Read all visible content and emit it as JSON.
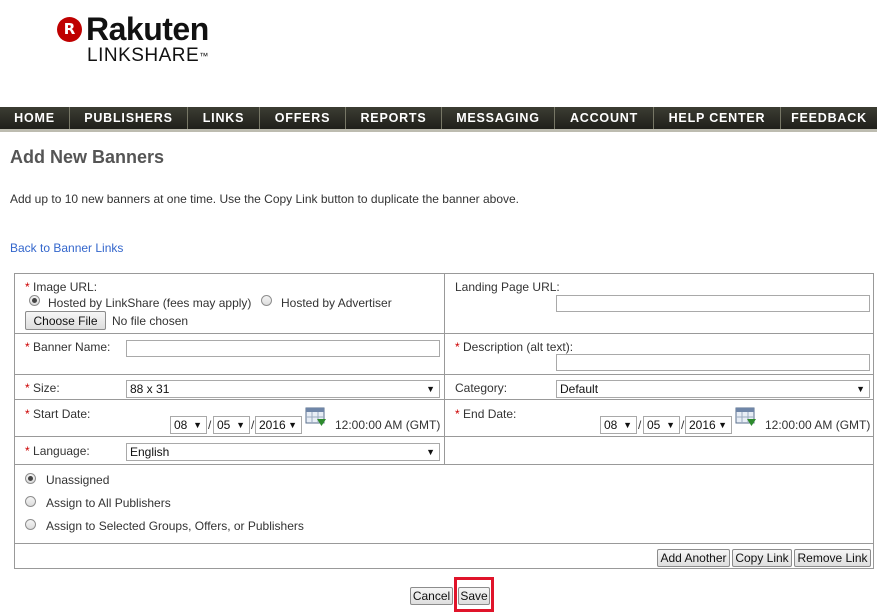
{
  "logo": {
    "mark": "R",
    "word": "Rakuten",
    "sub": "LINKSHARE",
    "tm": "™"
  },
  "nav": [
    "HOME",
    "PUBLISHERS",
    "LINKS",
    "OFFERS",
    "REPORTS",
    "MESSAGING",
    "ACCOUNT",
    "HELP CENTER",
    "FEEDBACK"
  ],
  "page": {
    "title": "Add New Banners",
    "intro": "Add up to 10 new banners at one time. Use the Copy Link button to duplicate the banner above.",
    "back_link": "Back to Banner Links"
  },
  "form": {
    "image_url_label": "Image URL:",
    "hosted_linkshare": "Hosted by LinkShare (fees may apply)",
    "hosted_advertiser": "Hosted by Advertiser",
    "choose_file": "Choose File",
    "no_file": "No file chosen",
    "landing_page_label": "Landing Page URL:",
    "landing_page_value": "",
    "banner_name_label": "Banner Name:",
    "banner_name_value": "",
    "description_label": "Description (alt text):",
    "description_value": "",
    "size_label": "Size:",
    "size_value": "88 x 31",
    "category_label": "Category:",
    "category_value": "Default",
    "start_date_label": "Start Date:",
    "end_date_label": "End Date:",
    "start": {
      "month": "08",
      "day": "05",
      "year": "2016",
      "time": "12:00:00 AM (GMT)"
    },
    "end": {
      "month": "08",
      "day": "05",
      "year": "2016",
      "time": "12:00:00 AM (GMT)"
    },
    "date_sep": "/",
    "language_label": "Language:",
    "language_value": "English",
    "required_mark": "*",
    "assign": {
      "unassigned": "Unassigned",
      "all": "Assign to All Publishers",
      "selected": "Assign to Selected Groups, Offers, or Publishers",
      "selected_option": "unassigned"
    },
    "add_another": "Add Another",
    "copy_link": "Copy Link",
    "remove_link": "Remove Link"
  },
  "actions": {
    "cancel": "Cancel",
    "save": "Save"
  },
  "colors": {
    "required": "#cc0000",
    "link": "#3366cc",
    "highlight": "#e0142a",
    "nav_bg": "#2b2b24"
  }
}
